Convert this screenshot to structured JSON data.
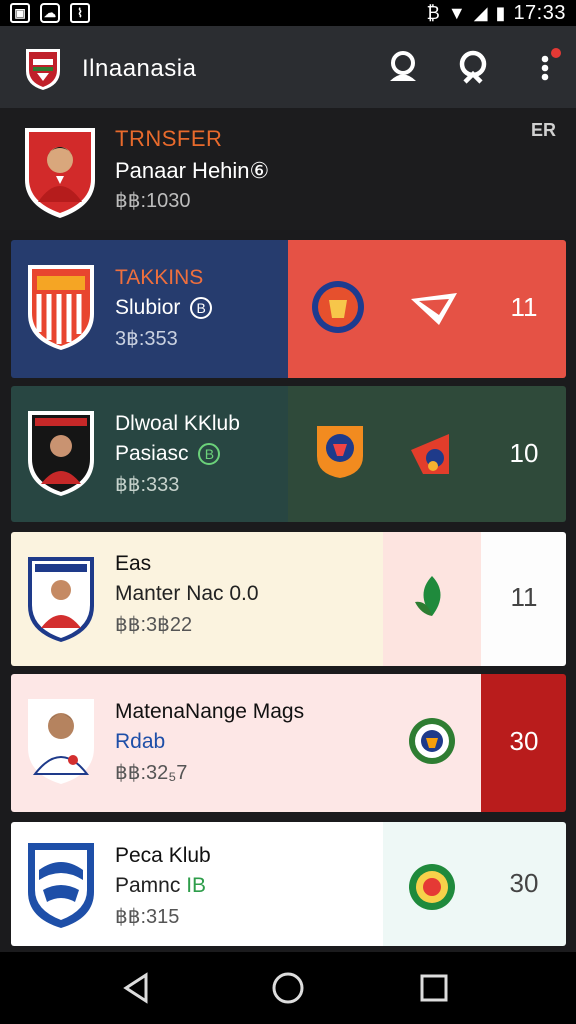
{
  "status_bar": {
    "time": "17:33"
  },
  "app_bar": {
    "title": "Ilnaanasia",
    "icons": [
      "crest-logo-icon",
      "profile-icon",
      "search-icon",
      "more-vert-icon"
    ]
  },
  "featured": {
    "tag": "TRNSFER",
    "name": "Panaar Hehin",
    "name_badge": "⑥",
    "fee": "฿฿:1030",
    "corner_label": "ER",
    "accent": "#e86a2c"
  },
  "cards": [
    {
      "tag": "TAKKINS",
      "subtitle": "Slubior",
      "badge": "B",
      "fee": "3฿:353",
      "score": "11",
      "left_bg": "#263c6e",
      "right_bg": "#e55245",
      "tag_color": "#ef6f3d"
    },
    {
      "tag": "Dlwoal KKlub",
      "subtitle": "Pasiasc",
      "badge": "B",
      "fee": "฿฿:333",
      "score": "10",
      "left_bg": "#284642",
      "right_bg": "#2f4a3a"
    },
    {
      "tag": "Eas",
      "subtitle": "Manter Nac 0.0",
      "fee": "฿฿:3฿22",
      "score": "11",
      "left_bg": "#fbf3df",
      "right_bg": "#fde4e0"
    },
    {
      "tag": "MatenaNange Mags",
      "subtitle": "Rdab",
      "fee": "฿฿:32₅7",
      "score": "30",
      "left_bg": "#fde7e6",
      "right_bg": "#b91c1c"
    },
    {
      "tag": "Peca Klub",
      "subtitle": "Pamnc",
      "badge": "IB",
      "fee": "฿฿:315",
      "score": "30",
      "left_bg": "#ffffff",
      "right_bg": "#eef8f6"
    }
  ],
  "nav": {
    "icons": [
      "back-icon",
      "home-icon",
      "recents-icon"
    ]
  }
}
